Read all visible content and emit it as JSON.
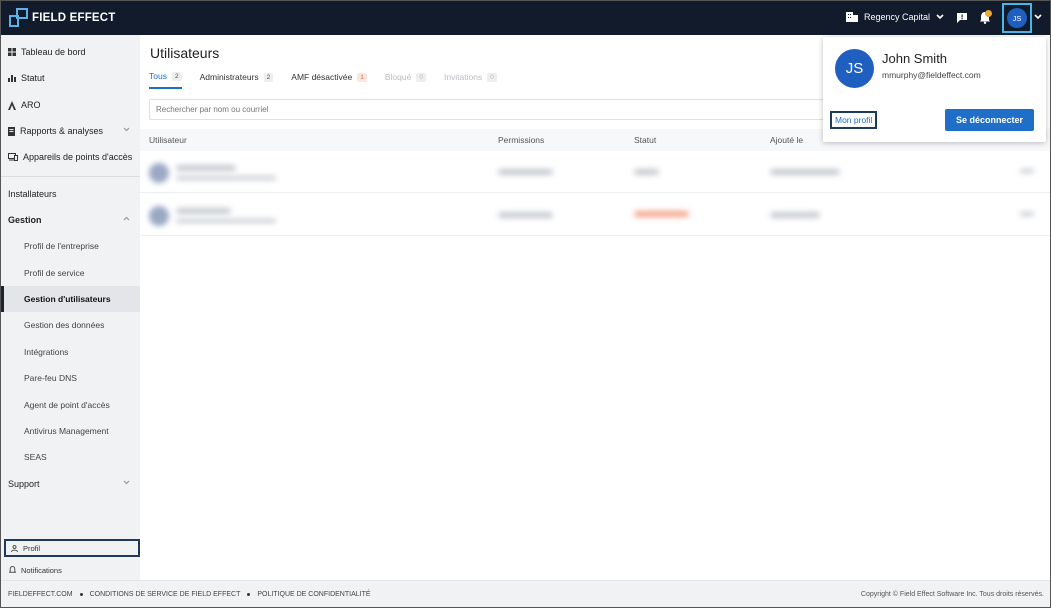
{
  "app": {
    "logo_text": "FIELD EFFECT",
    "organization": "Regency Capital",
    "user_initials": "JS"
  },
  "sidebar": {
    "items": [
      {
        "label": "Tableau de bord",
        "icon": "dashboard-icon"
      },
      {
        "label": "Statut",
        "icon": "bar-chart-icon"
      },
      {
        "label": "ARO",
        "icon": "aro-icon"
      },
      {
        "label": "Rapports & analyses",
        "icon": "report-icon"
      },
      {
        "label": "Appareils de points d'accès",
        "icon": "device-icon"
      },
      {
        "label": "Installateurs"
      },
      {
        "label": "Gestion"
      },
      {
        "label": "Profil de l'entreprise"
      },
      {
        "label": "Profil de service"
      },
      {
        "label": "Gestion d'utilisateurs"
      },
      {
        "label": "Gestion des données"
      },
      {
        "label": "Intégrations"
      },
      {
        "label": "Pare-feu DNS"
      },
      {
        "label": "Agent de point d'accès"
      },
      {
        "label": "Antivirus Management"
      },
      {
        "label": "SEAS"
      },
      {
        "label": "Support"
      }
    ],
    "profile": "Profil",
    "notifications": "Notifications"
  },
  "main": {
    "title": "Utilisateurs",
    "tabs": [
      {
        "label": "Tous",
        "count": "2"
      },
      {
        "label": "Administrateurs",
        "count": "2"
      },
      {
        "label": "AMF désactivée",
        "count": "1"
      },
      {
        "label": "Bloqué",
        "count": "0"
      },
      {
        "label": "Invitations",
        "count": "0"
      }
    ],
    "search_placeholder": "Rechercher par nom ou courriel",
    "columns": [
      "Utilisateur",
      "Permissions",
      "Statut",
      "Ajouté le"
    ]
  },
  "dropdown": {
    "initials": "JS",
    "name": "John Smith",
    "email": "mmurphy@fieldeffect.com",
    "my_profile": "Mon profil",
    "logout": "Se déconnecter"
  },
  "footer": {
    "links": [
      "FIELDEFFECT.COM",
      "CONDITIONS DE SERVICE DE FIELD EFFECT",
      "POLITIQUE DE CONFIDENTIALITÉ"
    ],
    "copyright": "Copyright © Field Effect Software Inc. Tous droits réservés."
  },
  "colors": {
    "topbar": "#111b2b",
    "accent": "#1f6fc8",
    "avatar": "#1f5fbf",
    "highlight": "#49b6e8"
  }
}
